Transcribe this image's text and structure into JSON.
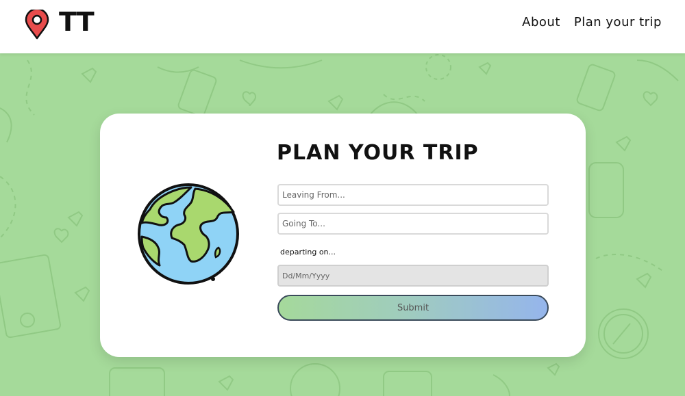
{
  "header": {
    "brand": "TT",
    "nav": [
      {
        "label": "About"
      },
      {
        "label": "Plan your trip"
      }
    ]
  },
  "form": {
    "title": "PLAN YOUR TRIP",
    "from_placeholder": "Leaving From...",
    "to_placeholder": "Going To...",
    "date_label": "departing on...",
    "date_placeholder": "Dd/Mm/Yyyy",
    "submit_label": "Submit"
  },
  "colors": {
    "background": "#a5da9a",
    "card": "#ffffff",
    "pin": "#e84c4c",
    "ocean": "#8fd3f6",
    "land": "#a9d86e",
    "submit_start": "#a5d99b",
    "submit_end": "#95b5ec"
  },
  "icons": [
    "map-pin-icon",
    "globe-icon"
  ]
}
